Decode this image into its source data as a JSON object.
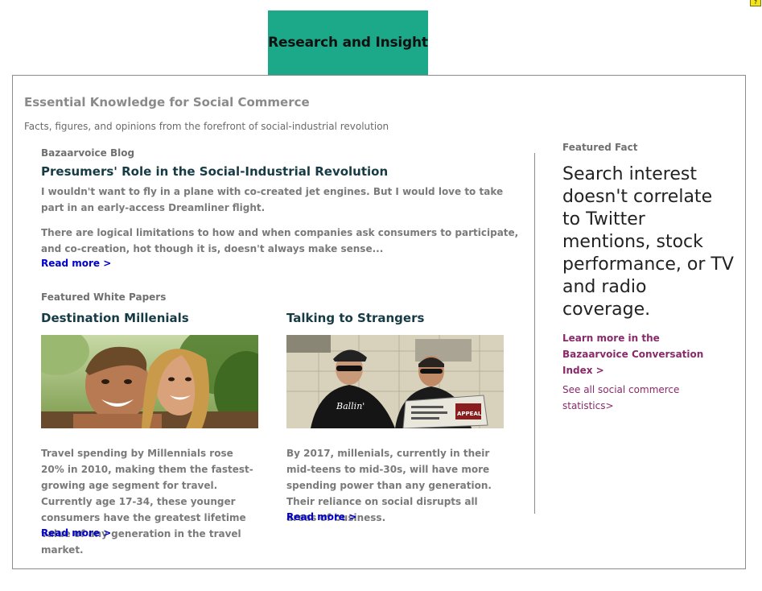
{
  "tab": {
    "label": "Research and Insight"
  },
  "corner": {
    "label": "?"
  },
  "section": {
    "title": "Essential Knowledge for Social Commerce",
    "subtitle": "Facts, figures, and opinions from the forefront of social-industrial revolution"
  },
  "blog": {
    "label": "Bazaarvoice Blog",
    "title": "Presumers' Role in the Social-Industrial Revolution",
    "paragraph1": "I wouldn't want to fly in a plane with co-created jet engines. But I would love to take part in an early-access Dreamliner flight.",
    "paragraph2": "There are logical limitations to how and when companies ask consumers to participate, and co-creation, hot though it is, doesn't always make sense...",
    "read_more": "Read more >"
  },
  "white_papers": {
    "label": "Featured White Papers",
    "items": [
      {
        "title": "Destination Millenials",
        "description": "Travel spending by Millennials rose 20% in 2010, making them the fastest-growing age segment for travel. Currently age 17-34, these younger consumers have the greatest lifetime value of any generation in the travel market.",
        "read_more": "Read more >"
      },
      {
        "title": "Talking to Strangers",
        "description": "By 2017, millenials, currently in their mid-teens to mid-30s, will have more spending power than any generation. Their reliance on social disrupts all areas of business.",
        "read_more": "Read more >"
      }
    ]
  },
  "featured_fact": {
    "label": "Featured Fact",
    "text": "Search interest doesn't correlate to Twitter mentions, stock performance, or TV and radio coverage.",
    "learn_more": "Learn more in the Bazaarvoice Conversation Index >",
    "see_all": "See all social commerce statistics>"
  },
  "colors": {
    "tab_bg": "#1ba98a",
    "headline": "#173b45",
    "link_blue": "#0000cc",
    "link_purple": "#8a2a6a",
    "muted_text": "#7a7a7a"
  }
}
